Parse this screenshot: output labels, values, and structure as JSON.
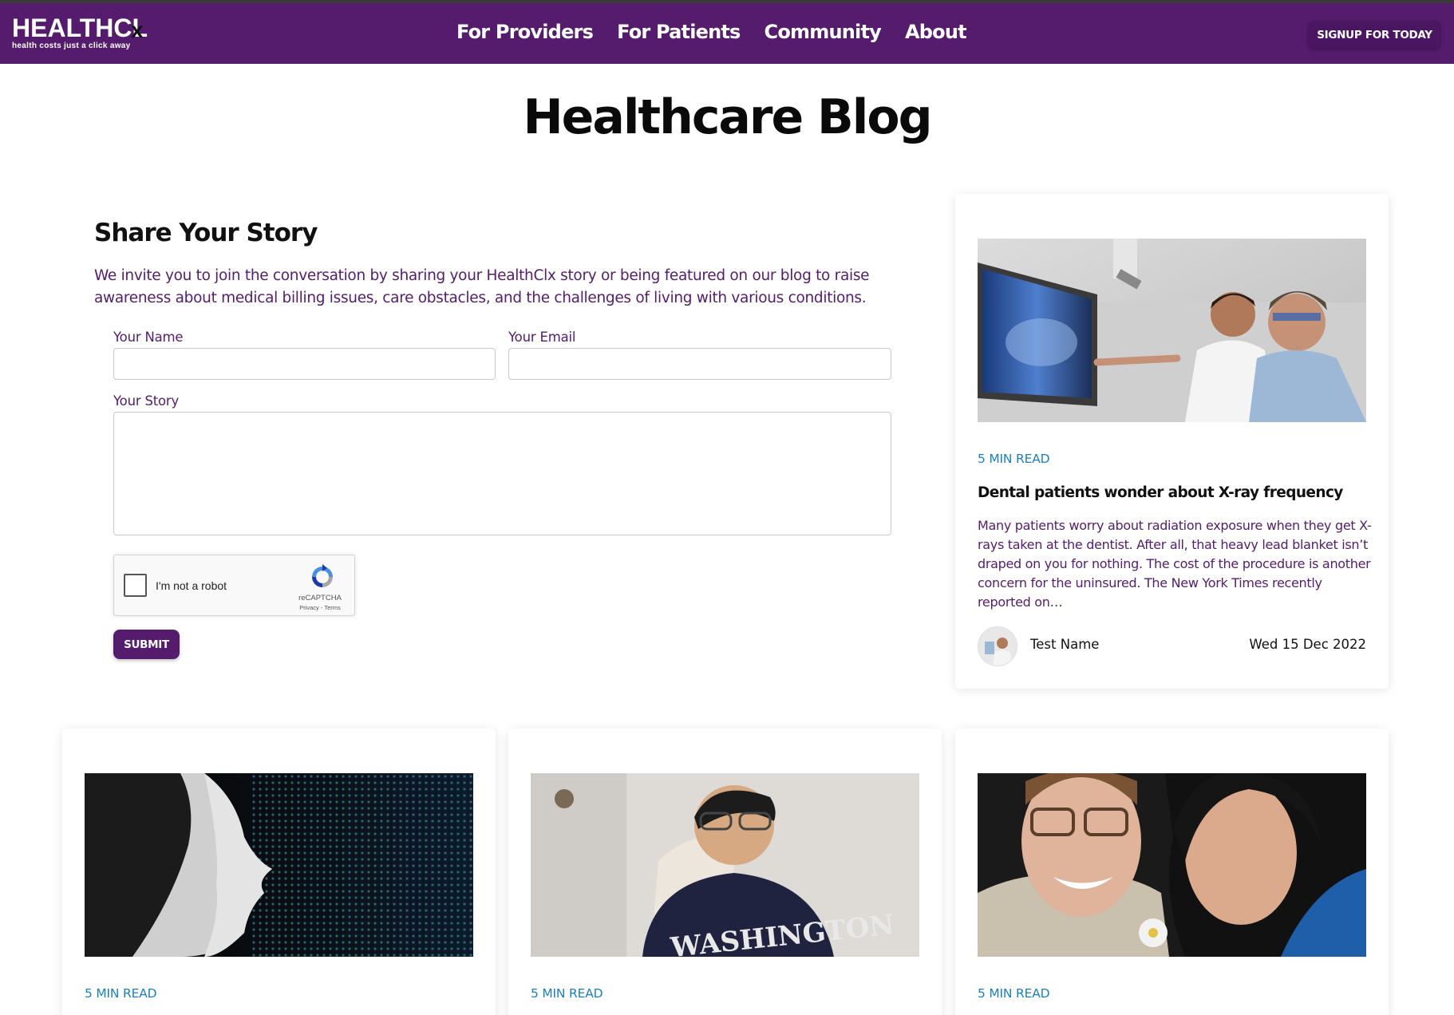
{
  "header": {
    "logo_main": "HEALTHCL",
    "logo_x": "x",
    "logo_tagline": "health costs just a click away",
    "nav": [
      "For Providers",
      "For Patients",
      "Community",
      "About"
    ],
    "signup_label": "SIGNUP FOR TODAY"
  },
  "page_title": "Healthcare Blog",
  "story_form": {
    "title": "Share Your Story",
    "description": "We invite you to join the conversation by sharing your HealthClx story or being featured on our blog to raise awareness about medical billing issues, care obstacles, and the challenges of living with various conditions.",
    "name_label": "Your Name",
    "name_value": "",
    "email_label": "Your Email",
    "email_value": "",
    "story_label": "Your Story",
    "story_value": "",
    "captcha": {
      "text": "I'm not a robot",
      "brand": "reCAPTCHA",
      "links": "Privacy - Terms"
    },
    "submit_label": "SUBMIT"
  },
  "featured_post": {
    "read_time": "5 MIN READ",
    "title": "Dental patients wonder about X-ray frequency",
    "excerpt": "Many patients worry about radiation exposure when they get X-rays taken at the dentist. After all, that heavy lead blanket isn’t draped on you for nothing. The cost of the procedure is another concern for the uninsured. The New York Times recently reported on…",
    "author": "Test Name",
    "date": "Wed 15 Dec 2022"
  },
  "posts": [
    {
      "read_time": "5 MIN READ"
    },
    {
      "read_time": "5 MIN READ"
    },
    {
      "read_time": "5 MIN READ"
    }
  ],
  "colors": {
    "brand_purple": "#551c6e",
    "read_time_blue": "#1a7fc1"
  }
}
